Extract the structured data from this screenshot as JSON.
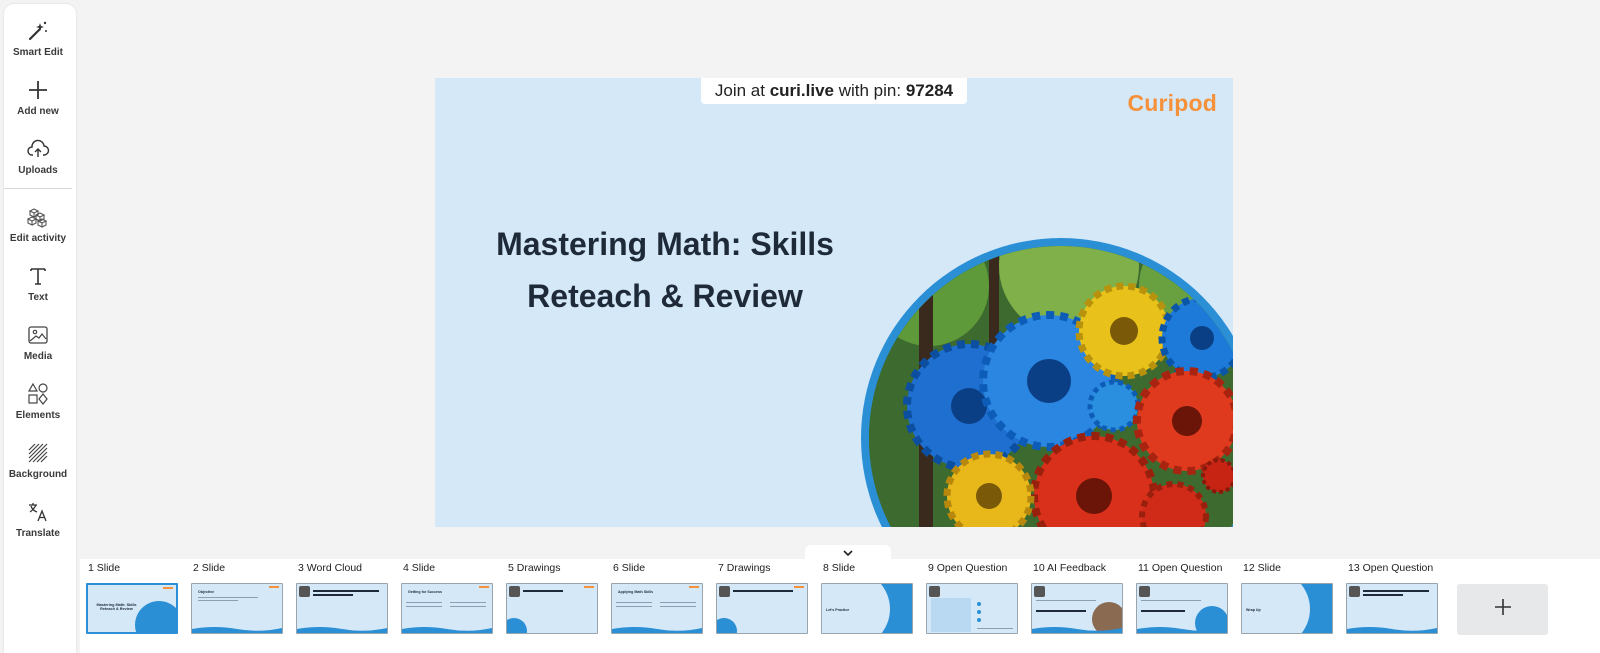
{
  "toolbar": {
    "items": [
      {
        "label": "Smart Edit",
        "icon": "magic-wand-icon"
      },
      {
        "label": "Add new",
        "icon": "plus-icon"
      },
      {
        "label": "Uploads",
        "icon": "cloud-upload-icon"
      },
      {
        "label": "Edit activity",
        "icon": "blocks-icon"
      },
      {
        "label": "Text",
        "icon": "text-t-icon"
      },
      {
        "label": "Media",
        "icon": "image-icon"
      },
      {
        "label": "Elements",
        "icon": "shapes-icon"
      },
      {
        "label": "Background",
        "icon": "hatch-icon"
      },
      {
        "label": "Translate",
        "icon": "translate-icon"
      }
    ]
  },
  "slide": {
    "join_prefix": "Join at",
    "join_site": "curi.live",
    "join_mid": "with pin:",
    "join_pin": "97284",
    "logo": "Curipod",
    "title_line1": "Mastering Math: Skills",
    "title_line2": "Reteach & Review"
  },
  "filmstrip": {
    "thumbs": [
      {
        "label": "1 Slide"
      },
      {
        "label": "2 Slide"
      },
      {
        "label": "3 Word Cloud"
      },
      {
        "label": "4 Slide"
      },
      {
        "label": "5 Drawings"
      },
      {
        "label": "6 Slide"
      },
      {
        "label": "7 Drawings"
      },
      {
        "label": "8 Slide"
      },
      {
        "label": "9 Open Question"
      },
      {
        "label": "10 AI Feedback"
      },
      {
        "label": "11 Open Question"
      },
      {
        "label": "12 Slide"
      },
      {
        "label": "13 Open Question"
      }
    ],
    "thumb_text": {
      "t1": "Mastering Math: Skills Reteach & Review",
      "t2": "Objective",
      "t4": "Getting for Success",
      "t6": "Applying Math Skills",
      "t8": "Let's Practice",
      "t12": "Wrap Up"
    }
  },
  "colors": {
    "accent": "#2b8fd6",
    "brand": "#f5913b",
    "slide_bg": "#d4e8f8"
  }
}
